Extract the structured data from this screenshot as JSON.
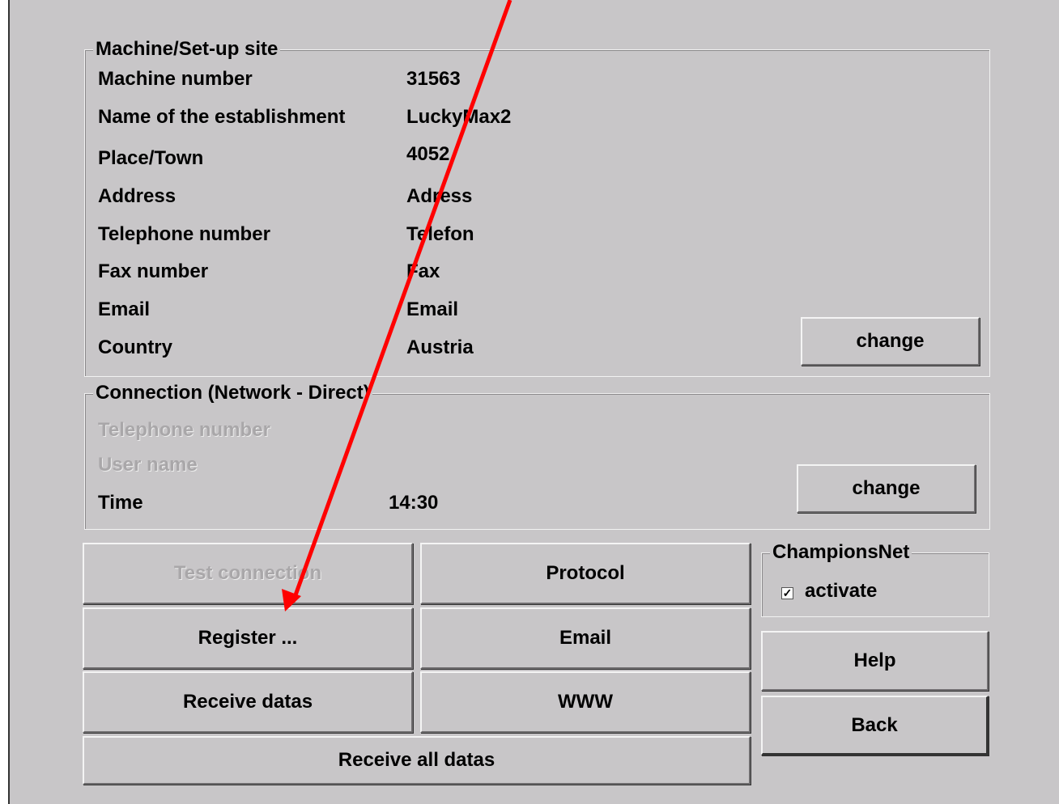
{
  "machine": {
    "title": "Machine/Set-up site",
    "rows": [
      {
        "label": "Machine number",
        "value": "31563"
      },
      {
        "label": "Name of the establishment",
        "value": "LuckyMax2"
      },
      {
        "label": "Place/Town",
        "value": "4052"
      },
      {
        "label": "Address",
        "value": "Adress"
      },
      {
        "label": "Telephone number",
        "value": "Telefon"
      },
      {
        "label": "Fax number",
        "value": "Fax"
      },
      {
        "label": "Email",
        "value": "Email"
      },
      {
        "label": "Country",
        "value": "Austria"
      }
    ],
    "change_label": "change"
  },
  "connection": {
    "title": "Connection (Network - Direct)",
    "telephone_label": "Telephone number",
    "username_label": "User name",
    "time_label": "Time",
    "time_value": "14:30",
    "change_label": "change"
  },
  "buttons": {
    "test_connection": "Test connection",
    "protocol": "Protocol",
    "register": "Register ...",
    "email": "Email",
    "receive_datas": "Receive datas",
    "www": "WWW",
    "receive_all_datas": "Receive all datas",
    "help": "Help",
    "back": "Back"
  },
  "championsnet": {
    "title": "ChampionsNet",
    "activate_label": "activate",
    "activate_checked": true
  },
  "annotation": {
    "arrow_color": "#ff0000"
  }
}
